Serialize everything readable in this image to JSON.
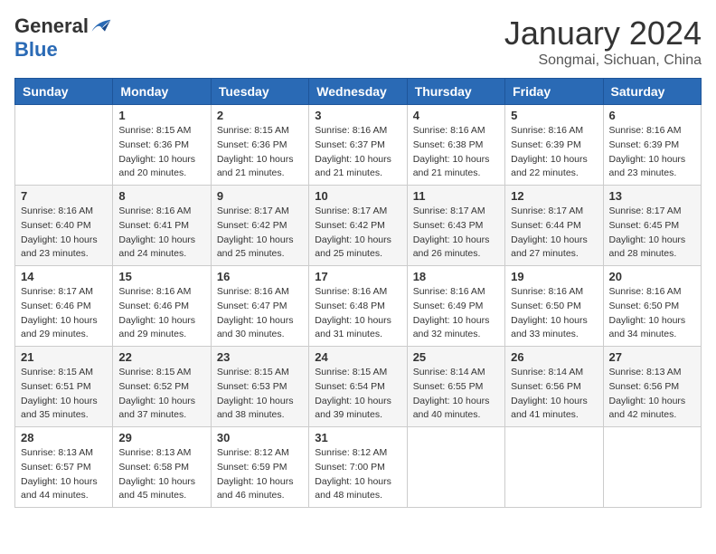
{
  "logo": {
    "general": "General",
    "blue": "Blue"
  },
  "title": "January 2024",
  "subtitle": "Songmai, Sichuan, China",
  "header_days": [
    "Sunday",
    "Monday",
    "Tuesday",
    "Wednesday",
    "Thursday",
    "Friday",
    "Saturday"
  ],
  "weeks": [
    [
      {
        "day": "",
        "info": ""
      },
      {
        "day": "1",
        "info": "Sunrise: 8:15 AM\nSunset: 6:36 PM\nDaylight: 10 hours\nand 20 minutes."
      },
      {
        "day": "2",
        "info": "Sunrise: 8:15 AM\nSunset: 6:36 PM\nDaylight: 10 hours\nand 21 minutes."
      },
      {
        "day": "3",
        "info": "Sunrise: 8:16 AM\nSunset: 6:37 PM\nDaylight: 10 hours\nand 21 minutes."
      },
      {
        "day": "4",
        "info": "Sunrise: 8:16 AM\nSunset: 6:38 PM\nDaylight: 10 hours\nand 21 minutes."
      },
      {
        "day": "5",
        "info": "Sunrise: 8:16 AM\nSunset: 6:39 PM\nDaylight: 10 hours\nand 22 minutes."
      },
      {
        "day": "6",
        "info": "Sunrise: 8:16 AM\nSunset: 6:39 PM\nDaylight: 10 hours\nand 23 minutes."
      }
    ],
    [
      {
        "day": "7",
        "info": "Sunrise: 8:16 AM\nSunset: 6:40 PM\nDaylight: 10 hours\nand 23 minutes."
      },
      {
        "day": "8",
        "info": "Sunrise: 8:16 AM\nSunset: 6:41 PM\nDaylight: 10 hours\nand 24 minutes."
      },
      {
        "day": "9",
        "info": "Sunrise: 8:17 AM\nSunset: 6:42 PM\nDaylight: 10 hours\nand 25 minutes."
      },
      {
        "day": "10",
        "info": "Sunrise: 8:17 AM\nSunset: 6:42 PM\nDaylight: 10 hours\nand 25 minutes."
      },
      {
        "day": "11",
        "info": "Sunrise: 8:17 AM\nSunset: 6:43 PM\nDaylight: 10 hours\nand 26 minutes."
      },
      {
        "day": "12",
        "info": "Sunrise: 8:17 AM\nSunset: 6:44 PM\nDaylight: 10 hours\nand 27 minutes."
      },
      {
        "day": "13",
        "info": "Sunrise: 8:17 AM\nSunset: 6:45 PM\nDaylight: 10 hours\nand 28 minutes."
      }
    ],
    [
      {
        "day": "14",
        "info": "Sunrise: 8:17 AM\nSunset: 6:46 PM\nDaylight: 10 hours\nand 29 minutes."
      },
      {
        "day": "15",
        "info": "Sunrise: 8:16 AM\nSunset: 6:46 PM\nDaylight: 10 hours\nand 29 minutes."
      },
      {
        "day": "16",
        "info": "Sunrise: 8:16 AM\nSunset: 6:47 PM\nDaylight: 10 hours\nand 30 minutes."
      },
      {
        "day": "17",
        "info": "Sunrise: 8:16 AM\nSunset: 6:48 PM\nDaylight: 10 hours\nand 31 minutes."
      },
      {
        "day": "18",
        "info": "Sunrise: 8:16 AM\nSunset: 6:49 PM\nDaylight: 10 hours\nand 32 minutes."
      },
      {
        "day": "19",
        "info": "Sunrise: 8:16 AM\nSunset: 6:50 PM\nDaylight: 10 hours\nand 33 minutes."
      },
      {
        "day": "20",
        "info": "Sunrise: 8:16 AM\nSunset: 6:50 PM\nDaylight: 10 hours\nand 34 minutes."
      }
    ],
    [
      {
        "day": "21",
        "info": "Sunrise: 8:15 AM\nSunset: 6:51 PM\nDaylight: 10 hours\nand 35 minutes."
      },
      {
        "day": "22",
        "info": "Sunrise: 8:15 AM\nSunset: 6:52 PM\nDaylight: 10 hours\nand 37 minutes."
      },
      {
        "day": "23",
        "info": "Sunrise: 8:15 AM\nSunset: 6:53 PM\nDaylight: 10 hours\nand 38 minutes."
      },
      {
        "day": "24",
        "info": "Sunrise: 8:15 AM\nSunset: 6:54 PM\nDaylight: 10 hours\nand 39 minutes."
      },
      {
        "day": "25",
        "info": "Sunrise: 8:14 AM\nSunset: 6:55 PM\nDaylight: 10 hours\nand 40 minutes."
      },
      {
        "day": "26",
        "info": "Sunrise: 8:14 AM\nSunset: 6:56 PM\nDaylight: 10 hours\nand 41 minutes."
      },
      {
        "day": "27",
        "info": "Sunrise: 8:13 AM\nSunset: 6:56 PM\nDaylight: 10 hours\nand 42 minutes."
      }
    ],
    [
      {
        "day": "28",
        "info": "Sunrise: 8:13 AM\nSunset: 6:57 PM\nDaylight: 10 hours\nand 44 minutes."
      },
      {
        "day": "29",
        "info": "Sunrise: 8:13 AM\nSunset: 6:58 PM\nDaylight: 10 hours\nand 45 minutes."
      },
      {
        "day": "30",
        "info": "Sunrise: 8:12 AM\nSunset: 6:59 PM\nDaylight: 10 hours\nand 46 minutes."
      },
      {
        "day": "31",
        "info": "Sunrise: 8:12 AM\nSunset: 7:00 PM\nDaylight: 10 hours\nand 48 minutes."
      },
      {
        "day": "",
        "info": ""
      },
      {
        "day": "",
        "info": ""
      },
      {
        "day": "",
        "info": ""
      }
    ]
  ]
}
